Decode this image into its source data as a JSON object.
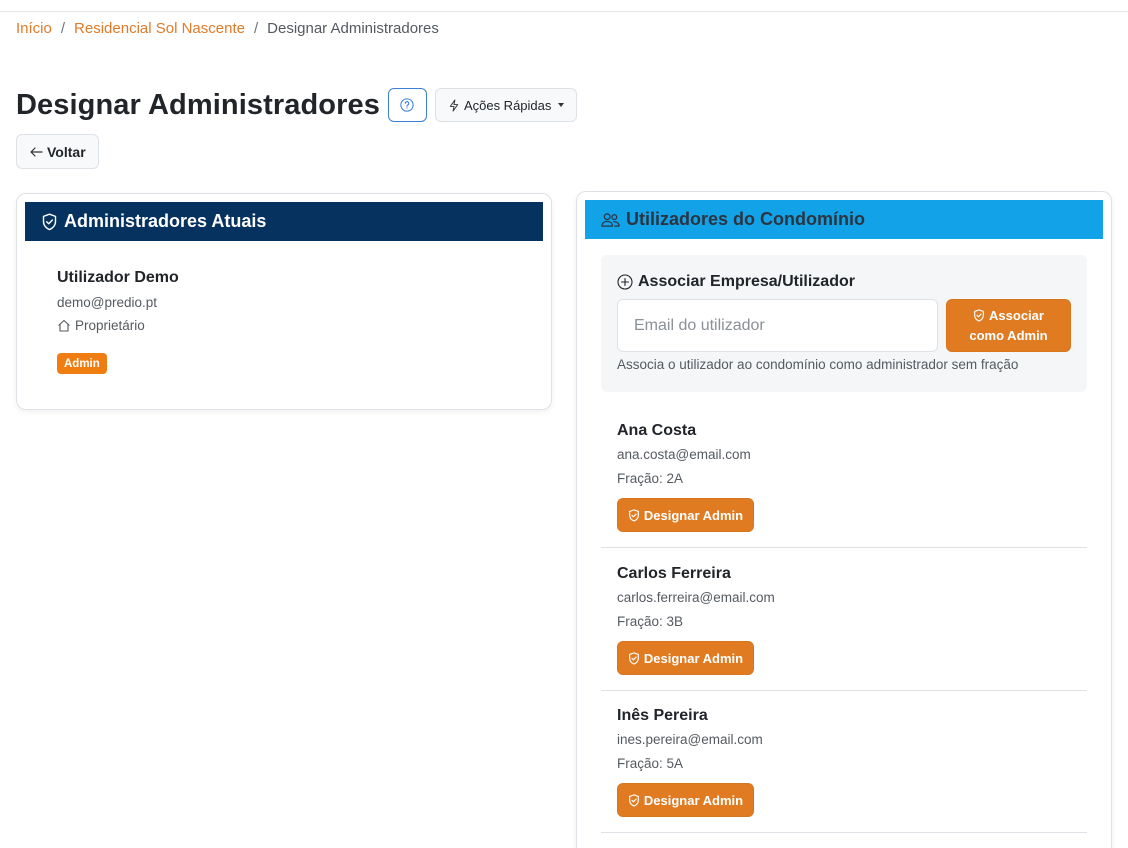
{
  "breadcrumb": {
    "home": "Início",
    "condo": "Residencial Sol Nascente",
    "current": "Designar Administradores",
    "separator": "/"
  },
  "header": {
    "title": "Designar Administradores",
    "quick_actions_label": "Ações Rápidas",
    "back_label": "Voltar"
  },
  "admins_card": {
    "title": "Administradores Atuais",
    "admins": [
      {
        "name": "Utilizador Demo",
        "email": "demo@predio.pt",
        "role": "Proprietário",
        "badge": "Admin"
      }
    ]
  },
  "users_card": {
    "title": "Utilizadores do Condomínio",
    "associate": {
      "title": "Associar Empresa/Utilizador",
      "input_placeholder": "Email do utilizador",
      "input_value": "",
      "button_line1": "Associar",
      "button_line2": "como Admin",
      "help_text": "Associa o utilizador ao condomínio como administrador sem fração"
    },
    "users": [
      {
        "name": "Ana Costa",
        "email": "ana.costa@email.com",
        "fraction": "Fração: 2A",
        "button": "Designar Admin"
      },
      {
        "name": "Carlos Ferreira",
        "email": "carlos.ferreira@email.com",
        "fraction": "Fração: 3B",
        "button": "Designar Admin"
      },
      {
        "name": "Inês Pereira",
        "email": "ines.pereira@email.com",
        "fraction": "Fração: 5A",
        "button": "Designar Admin"
      }
    ]
  },
  "colors": {
    "accent_orange": "#e07b22",
    "link_orange": "#e07b2a",
    "navy_header": "#05325f",
    "sky_header": "#12a2e8",
    "badge_orange": "#ef7d12"
  },
  "icons": {
    "help": "question-circle-icon",
    "quick_actions": "lightning-icon",
    "back": "arrow-left-icon",
    "admins_header": "shield-check-icon",
    "users_header": "people-icon",
    "associate": "plus-circle-icon",
    "role": "house-icon",
    "designate": "shield-check-icon"
  }
}
